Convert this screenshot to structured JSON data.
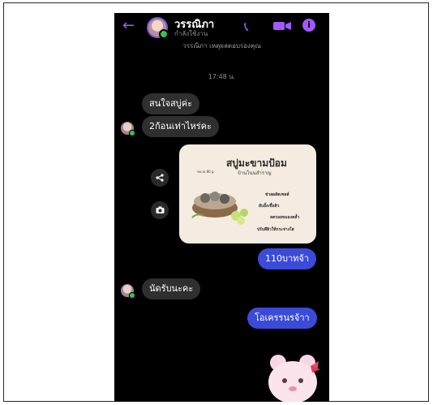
{
  "header": {
    "back_icon": "arrow-left-icon",
    "contact_name": "วรรณิภา",
    "status": "กำลังใช้งาน",
    "icons": [
      "phone-icon",
      "video-icon",
      "info-icon"
    ],
    "accent_color": "#a259ff"
  },
  "conversation": {
    "nickname_note": "วรรณิภา เหตุผลตอบรองคุณ",
    "timestamp": "17:48 น.",
    "messages": [
      {
        "direction": "incoming",
        "text": "สนใจสบู่ค่ะ"
      },
      {
        "direction": "incoming",
        "text": "2ก้อนเท่าไหร่คะ"
      },
      {
        "direction": "outgoing",
        "type": "image",
        "card": {
          "title": "สบู่มะขามป้อม",
          "subtitle": "บ้านโนนสำราญ",
          "tag": "ขนาด 80 g",
          "benefits": [
            "ช่วยผลัดเซลล์",
            "ยับยั้งเชื้อสิว",
            "ลดรอยหมองคล้ำ",
            "ปรับสีผิวให้กระจ่างใส"
          ]
        }
      },
      {
        "direction": "outgoing",
        "text": "110บาทจ้า"
      },
      {
        "direction": "incoming",
        "text": "นัดรับนะคะ"
      },
      {
        "direction": "outgoing",
        "text": "โอเครรนรจ้าา"
      },
      {
        "direction": "outgoing",
        "type": "sticker",
        "sticker": "pink-bear-sticker"
      }
    ]
  },
  "colors": {
    "incoming_bubble": "#2f2f2f",
    "outgoing_bubble": "#3b4bd8",
    "background": "#000000"
  }
}
